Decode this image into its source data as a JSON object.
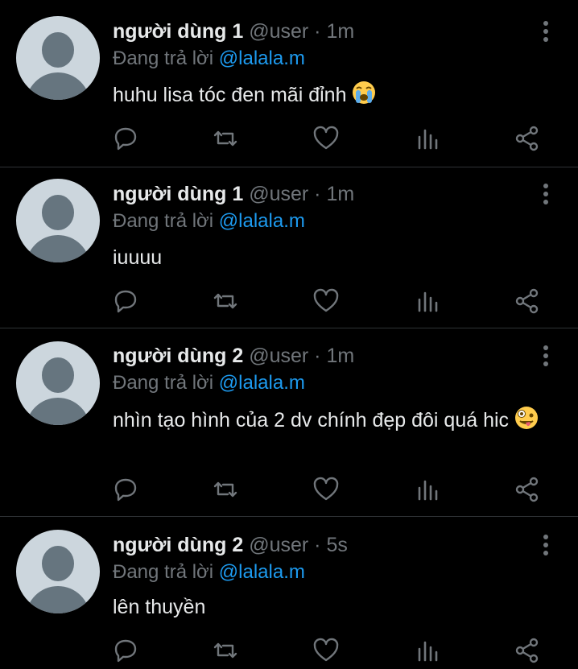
{
  "colors": {
    "background": "#000000",
    "name": "#e7e9ea",
    "secondary": "#71767b",
    "mention": "#1d9bf0",
    "divider": "#2f3336"
  },
  "tweets": [
    {
      "name": "người dùng 1",
      "handle": "@user",
      "dot": "·",
      "time": "1m",
      "reply_prefix": "Đang trả lời",
      "reply_to": "@lalala.m",
      "text": "huhu lisa tóc đen mãi đỉnh",
      "emoji": "loudly-crying-face"
    },
    {
      "name": "người dùng 1",
      "handle": "@user",
      "dot": "·",
      "time": "1m",
      "reply_prefix": "Đang trả lời",
      "reply_to": "@lalala.m",
      "text": "iuuuu",
      "emoji": ""
    },
    {
      "name": "người dùng 2",
      "handle": "@user",
      "dot": "·",
      "time": "1m",
      "reply_prefix": "Đang trả lời",
      "reply_to": "@lalala.m",
      "text": "nhìn tạo hình của 2 dv chính đẹp đôi quá hic",
      "emoji": "zany-face"
    },
    {
      "name": "người dùng 2",
      "handle": "@user",
      "dot": "·",
      "time": "5s",
      "reply_prefix": "Đang trả lời",
      "reply_to": "@lalala.m",
      "text": "lên thuyền",
      "emoji": ""
    }
  ],
  "action_icons": [
    "reply-icon",
    "retweet-icon",
    "like-icon",
    "analytics-icon",
    "share-icon"
  ]
}
